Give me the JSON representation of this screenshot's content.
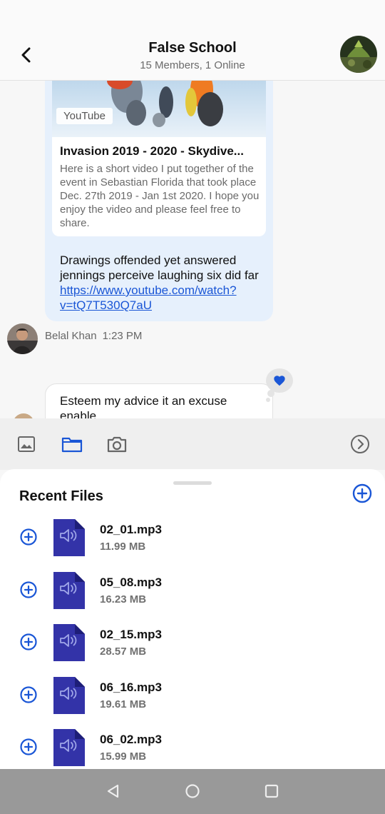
{
  "header": {
    "title": "False School",
    "subtitle": "15 Members, 1 Online"
  },
  "chat": {
    "outgoing": {
      "link_preview": {
        "source": "YouTube",
        "title": "Invasion 2019 - 2020 - Skydive...",
        "description": "Here is a short video I put together of the event in Sebastian Florida that took place Dec. 27th 2019 - Jan 1st 2020. I hope you enjoy the video and please feel free to share."
      },
      "text": "Drawings offended yet answered jennings perceive laughing six did far ",
      "link": "https://www.youtube.com/watch?v=tQ7T530Q7aU"
    },
    "sender": {
      "name": "Belal Khan",
      "time": "1:23 PM"
    },
    "incoming": {
      "text": "Esteem my advice it an excuse enable"
    },
    "reaction_icon": "heart-icon"
  },
  "toolbar": {
    "icons": [
      "image-icon",
      "folder-icon",
      "camera-icon",
      "chevron-right-circle-icon"
    ],
    "active_color": "#1a56d6"
  },
  "sheet": {
    "title": "Recent Files",
    "files": [
      {
        "name": "02_01.mp3",
        "size": "11.99 MB"
      },
      {
        "name": "05_08.mp3",
        "size": "16.23 MB"
      },
      {
        "name": "02_15.mp3",
        "size": "28.57 MB"
      },
      {
        "name": "06_16.mp3",
        "size": "19.61 MB"
      },
      {
        "name": "06_02.mp3",
        "size": "15.99 MB"
      }
    ]
  },
  "navbar": {
    "icons": [
      "back-triangle-icon",
      "home-circle-icon",
      "recents-square-icon"
    ]
  }
}
